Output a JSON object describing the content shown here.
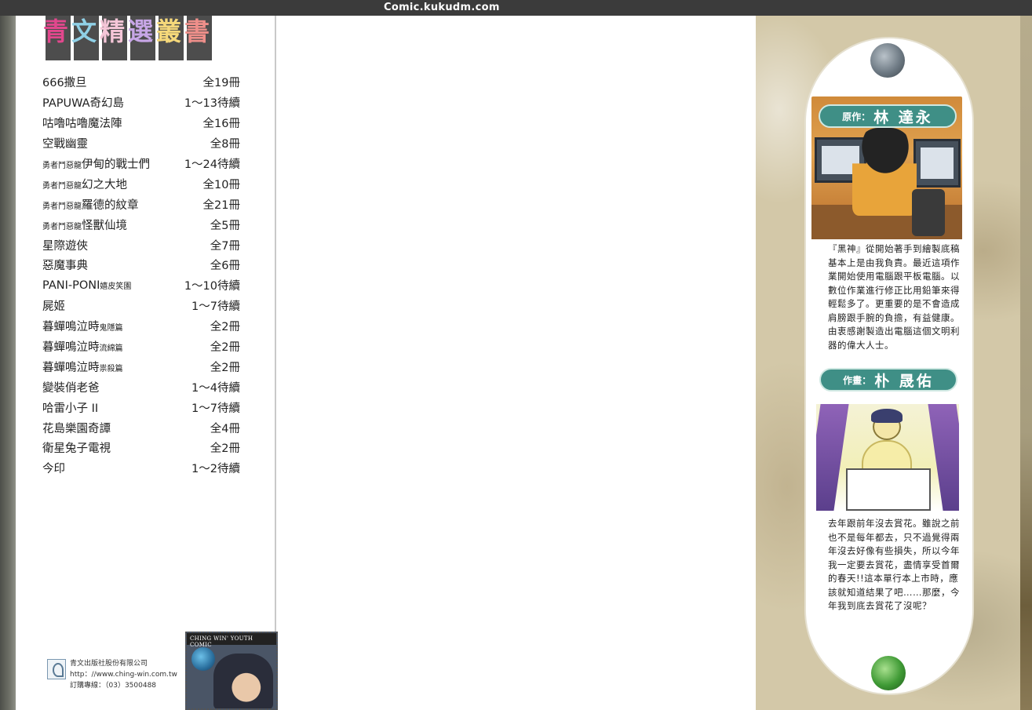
{
  "header": {
    "site": "Comic.kukudm.com"
  },
  "series_logo": {
    "chars": [
      "青",
      "文",
      "精",
      "選",
      "叢",
      "書"
    ],
    "colors": [
      "#e2478d",
      "#8fd0e6",
      "#f5c6d8",
      "#c7a6e6",
      "#f5d87a",
      "#ee8f8a"
    ]
  },
  "booklist": [
    {
      "prefix": "",
      "title": "666撒旦",
      "suffix": "",
      "count": "全19冊"
    },
    {
      "prefix": "",
      "title": "PAPUWA奇幻島",
      "suffix": "",
      "count": "1～13待續"
    },
    {
      "prefix": "",
      "title": "咕嚕咕嚕魔法陣",
      "suffix": "",
      "count": "全16冊"
    },
    {
      "prefix": "",
      "title": "空戰幽靈",
      "suffix": "",
      "count": "全8冊"
    },
    {
      "prefix": "勇者鬥惡龍",
      "title": "伊甸的戰士們",
      "suffix": "",
      "count": "1～24待續"
    },
    {
      "prefix": "勇者鬥惡龍",
      "title": "幻之大地",
      "suffix": "",
      "count": "全10冊"
    },
    {
      "prefix": "勇者鬥惡龍",
      "title": "羅德的紋章",
      "suffix": "",
      "count": "全21冊"
    },
    {
      "prefix": "勇者鬥惡龍",
      "title": "怪獸仙境",
      "suffix": "",
      "count": "全5冊"
    },
    {
      "prefix": "",
      "title": "星際遊俠",
      "suffix": "",
      "count": "全7冊"
    },
    {
      "prefix": "",
      "title": "惡魔事典",
      "suffix": "",
      "count": "全6冊"
    },
    {
      "prefix": "",
      "title": "PANI-PONI",
      "suffix": "嬉皮笑園",
      "count": "1～10待續"
    },
    {
      "prefix": "",
      "title": "屍姬",
      "suffix": "",
      "count": "1～7待續"
    },
    {
      "prefix": "",
      "title": "暮蟬鳴泣時",
      "suffix": "鬼隱篇",
      "count": "全2冊"
    },
    {
      "prefix": "",
      "title": "暮蟬鳴泣時",
      "suffix": "流綿篇",
      "count": "全2冊"
    },
    {
      "prefix": "",
      "title": "暮蟬鳴泣時",
      "suffix": "祟殺篇",
      "count": "全2冊"
    },
    {
      "prefix": "",
      "title": "變裝俏老爸",
      "suffix": "",
      "count": "1～4待續"
    },
    {
      "prefix": "",
      "title": "哈雷小子 II",
      "suffix": "",
      "count": "1～7待續"
    },
    {
      "prefix": "",
      "title": "花島樂園奇譚",
      "suffix": "",
      "count": "全4冊"
    },
    {
      "prefix": "",
      "title": "衛星兔子電視",
      "suffix": "",
      "count": "全2冊"
    },
    {
      "prefix": "",
      "title": "今印",
      "suffix": "",
      "count": "1～2待續"
    }
  ],
  "publisher": {
    "name": "青文出版社股份有限公司",
    "url": "http：//www.ching-win.com.tw",
    "phone": "訂購專線：（03）3500488"
  },
  "youth_comic": {
    "label": "CHING WIN' YOUTH COMIC"
  },
  "creators": {
    "author": {
      "role": "原作：",
      "name": "林 達永"
    },
    "artist": {
      "role": "作畫：",
      "name": "朴 晟佑"
    }
  },
  "author_note": "『黑神』從開始著手到繪製底稿基本上是由我負責。最近這項作業開始使用電腦跟平板電腦。以數位作業進行修正比用鉛筆來得輕鬆多了。更重要的是不會造成肩膀跟手腕的負擔，有益健康。由衷感謝製造出電腦這個文明利器的偉大人士。",
  "artist_note": "去年跟前年沒去賞花。雖說之前也不是每年都去，只不過覺得兩年沒去好像有些損失，所以今年我一定要去賞花，盡情享受首爾的春天!!這本單行本上市時，應該就知道結果了吧……那麼，今年我到底去賞花了沒呢？"
}
